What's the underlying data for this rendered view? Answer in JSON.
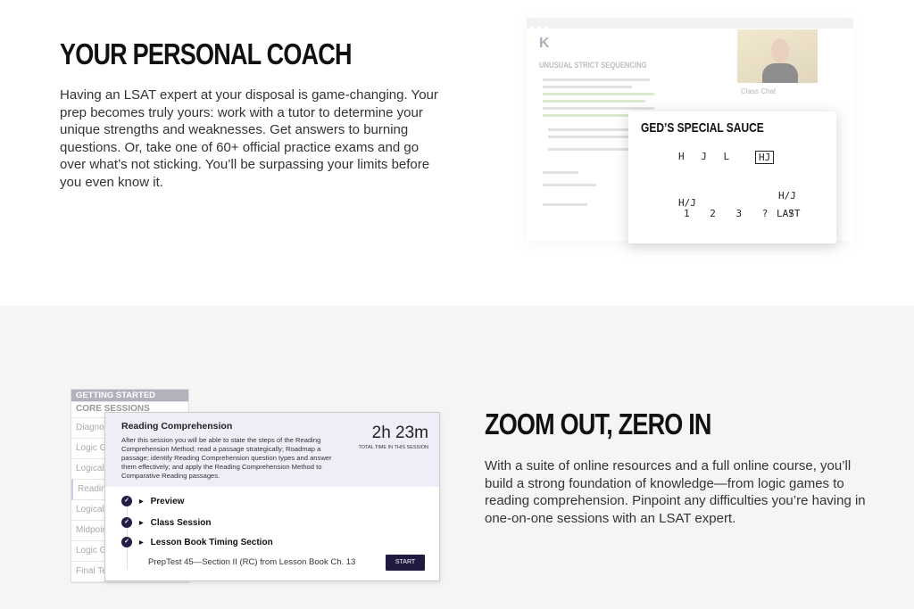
{
  "coach": {
    "title": "YOUR PERSONAL COACH",
    "body": "Having an LSAT expert at your disposal is game-changing. Your prep becomes truly yours: work with a tutor to determine your unique strengths and weaknesses. Get answers to burning questions. Or, take one of 60+ official practice exams and go over what’s not sticking. You’ll be surpassing your limits before you even know it.",
    "mock": {
      "logo": "K",
      "heading": "UNUSUAL STRICT SEQUENCING",
      "chat_label": "Class Chat",
      "whiteboard_title": "GED’S SPECIAL SAUCE",
      "whiteboard_notes": [
        "H J L",
        "HJ",
        "H/J",
        "1 2 3 ? ?",
        "H/J",
        "LAST"
      ]
    }
  },
  "zoom": {
    "title": "ZOOM OUT, ZERO IN",
    "body": "With a suite of online resources and a full online course, you’ll build a strong foundation of knowledge—from logic games to reading comprehension. Pinpoint any difficulties you’re having in one-on-one sessions with an LSAT expert.",
    "mock": {
      "sidebar": {
        "header": "GETTING STARTED",
        "section": "CORE SESSIONS",
        "items": [
          "Diagnostic",
          "Logic Games",
          "Logical Reasoning",
          "Reading Comprehension",
          "Logical Reasoning",
          "Midpoint",
          "Logic Games",
          "Final Test"
        ]
      },
      "session": {
        "title": "Reading Comprehension",
        "description": "After this session you will be able to state the steps of the Reading Comprehension Method; read a passage strategically; Roadmap a passage; identify Reading Comprehension question types and answer them effectively; and apply the Reading Comprehension Method to Comparative Reading passages.",
        "time": "2h 23m",
        "time_label": "TOTAL TIME IN THIS SESSION",
        "steps": [
          "Preview",
          "Class Session",
          "Lesson Book Timing Section"
        ],
        "sub_item": "PrepTest 45—Section II (RC) from Lesson Book Ch. 13",
        "start_label": "START"
      }
    }
  }
}
